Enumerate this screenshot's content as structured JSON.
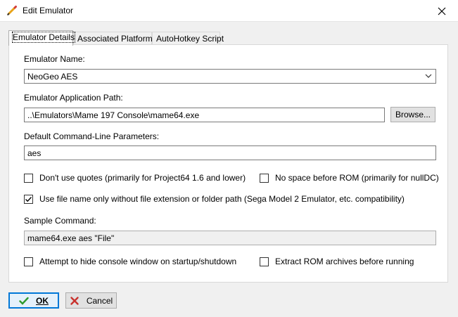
{
  "window": {
    "title": "Edit Emulator",
    "title_icon": "pencil-icon",
    "close_icon": "close-icon"
  },
  "tabs": [
    {
      "label": "Emulator Details",
      "active": true
    },
    {
      "label": "Associated Platforms",
      "active": false
    },
    {
      "label": "AutoHotkey Script",
      "active": false
    }
  ],
  "form": {
    "emulator_name_label": "Emulator Name:",
    "emulator_name_value": "NeoGeo AES",
    "app_path_label": "Emulator Application Path:",
    "app_path_value": "..\\Emulators\\Mame 197 Console\\mame64.exe",
    "browse_label": "Browse...",
    "params_label": "Default Command-Line Parameters:",
    "params_value": "aes",
    "sample_label": "Sample Command:",
    "sample_value": "mame64.exe aes \"File\""
  },
  "checkboxes": {
    "dont_use_quotes": {
      "label": "Don't use quotes (primarily for Project64 1.6 and lower)",
      "checked": false
    },
    "no_space_before_rom": {
      "label": "No space before ROM (primarily for nullDC)",
      "checked": false
    },
    "file_name_only": {
      "label": "Use file name only without file extension or folder path (Sega Model 2 Emulator, etc. compatibility)",
      "checked": true
    },
    "hide_console": {
      "label": "Attempt to hide console window on startup/shutdown",
      "checked": false
    },
    "extract_rom": {
      "label": "Extract ROM archives before running",
      "checked": false
    }
  },
  "footer": {
    "ok_label": "OK",
    "ok_icon": "checkmark-icon",
    "cancel_label": "Cancel",
    "cancel_icon": "cancel-icon"
  },
  "colors": {
    "accent": "#0078d7",
    "ok_check": "#2e9a2e",
    "cancel_x": "#c8322d"
  }
}
